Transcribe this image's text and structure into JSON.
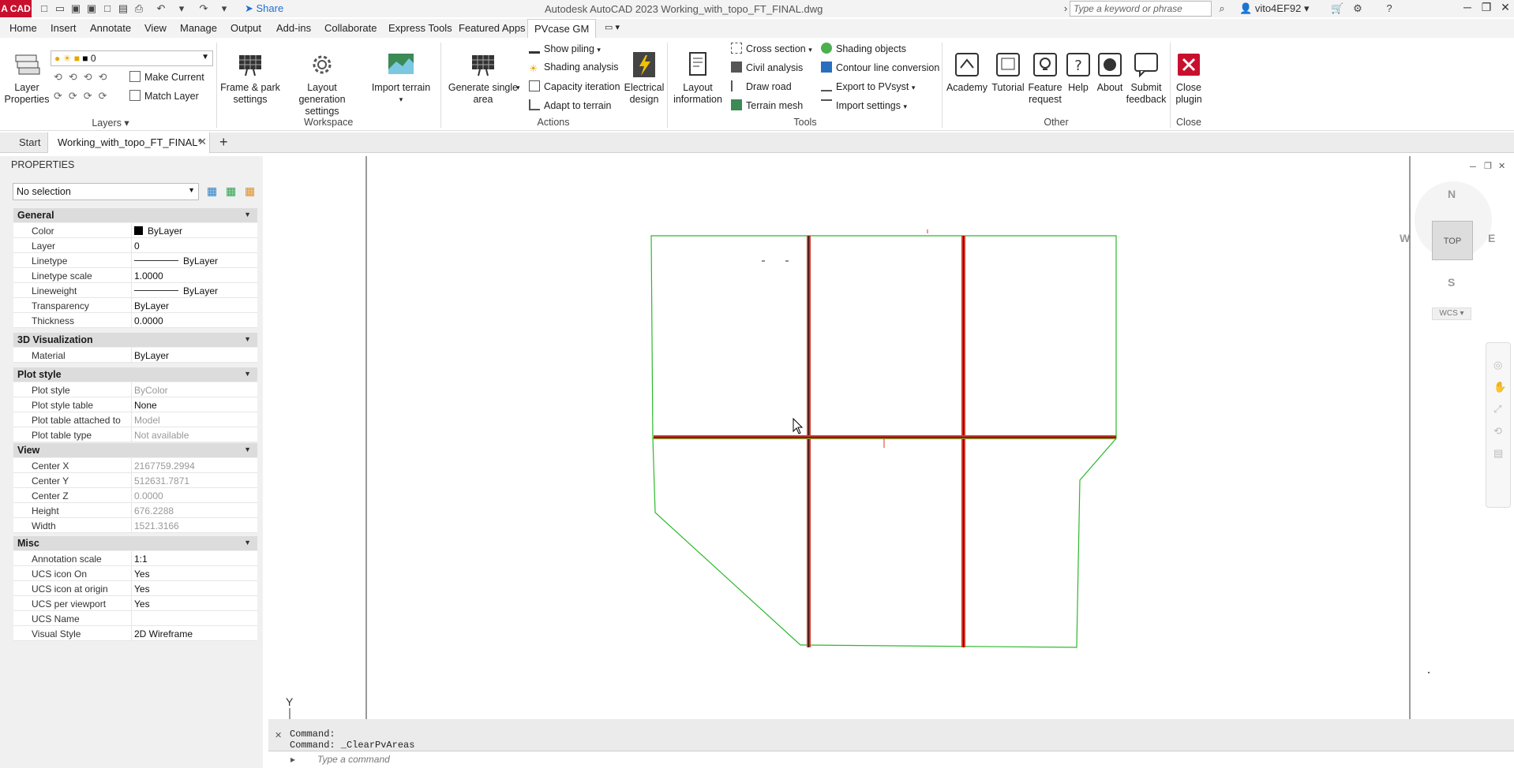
{
  "titlebar": {
    "logo": "A CAD",
    "share": "Share",
    "app_title": "Autodesk AutoCAD 2023   Working_with_topo_FT_FINAL.dwg",
    "search_placeholder": "Type a keyword or phrase",
    "user": "vito4EF92"
  },
  "menu": {
    "tabs": [
      "Home",
      "Insert",
      "Annotate",
      "View",
      "Manage",
      "Output",
      "Add-ins",
      "Collaborate",
      "Express Tools",
      "Featured Apps",
      "PVcase GM"
    ],
    "active": "PVcase GM"
  },
  "ribbon": {
    "layers": {
      "layer_properties": "Layer Properties",
      "layer_value": "0",
      "make_current": "Make Current",
      "match_layer": "Match Layer",
      "group": "Layers"
    },
    "workspace": {
      "frame_park": "Frame & park settings",
      "layout_gen": "Layout generation settings",
      "import_terrain": "Import terrain",
      "group": "Workspace"
    },
    "actions": {
      "generate_single": "Generate single area",
      "show_piling": "Show piling",
      "shading_analysis": "Shading analysis",
      "capacity_iteration": "Capacity iteration",
      "adapt_terrain": "Adapt to terrain",
      "electrical_design": "Electrical design",
      "group": "Actions"
    },
    "tools": {
      "layout_info": "Layout information",
      "cross_section": "Cross section",
      "civil_analysis": "Civil analysis",
      "draw_road": "Draw road",
      "terrain_mesh": "Terrain mesh",
      "shading_objects": "Shading objects",
      "contour_line": "Contour line conversion",
      "export_pvsyst": "Export to PVsyst",
      "import_settings": "Import settings",
      "group": "Tools"
    },
    "other": {
      "academy": "Academy",
      "tutorial": "Tutorial",
      "feature_request": "Feature request",
      "help": "Help",
      "about": "About",
      "submit_feedback": "Submit feedback",
      "group": "Other"
    },
    "close": {
      "close_plugin": "Close plugin",
      "group": "Close"
    }
  },
  "doctabs": {
    "start": "Start",
    "file": "Working_with_topo_FT_FINAL*"
  },
  "properties": {
    "title": "PROPERTIES",
    "selection": "No selection",
    "sections": {
      "general": "General",
      "viz3d": "3D Visualization",
      "plotstyle": "Plot style",
      "view": "View",
      "misc": "Misc"
    },
    "general": [
      [
        "Color",
        "ByLayer"
      ],
      [
        "Layer",
        "0"
      ],
      [
        "Linetype",
        "ByLayer"
      ],
      [
        "Linetype scale",
        "1.0000"
      ],
      [
        "Lineweight",
        "ByLayer"
      ],
      [
        "Transparency",
        "ByLayer"
      ],
      [
        "Thickness",
        "0.0000"
      ]
    ],
    "viz3d": [
      [
        "Material",
        "ByLayer"
      ]
    ],
    "plotstyle": [
      [
        "Plot style",
        "ByColor"
      ],
      [
        "Plot style table",
        "None"
      ],
      [
        "Plot table attached to",
        "Model"
      ],
      [
        "Plot table type",
        "Not available"
      ]
    ],
    "view": [
      [
        "Center X",
        "2167759.2994"
      ],
      [
        "Center Y",
        "512631.7871"
      ],
      [
        "Center Z",
        "0.0000"
      ],
      [
        "Height",
        "676.2288"
      ],
      [
        "Width",
        "1521.3166"
      ]
    ],
    "misc": [
      [
        "Annotation scale",
        "1:1"
      ],
      [
        "UCS icon On",
        "Yes"
      ],
      [
        "UCS icon at origin",
        "Yes"
      ],
      [
        "UCS per viewport",
        "Yes"
      ],
      [
        "UCS Name",
        ""
      ],
      [
        "Visual Style",
        "2D Wireframe"
      ]
    ]
  },
  "viewcube": {
    "n": "N",
    "s": "S",
    "e": "E",
    "w": "W",
    "top": "TOP",
    "wcs": "WCS"
  },
  "canvas": {
    "y_axis": "Y"
  },
  "command": {
    "line1": "Command:",
    "line2": "Command: _ClearPvAreas",
    "placeholder": "Type a command"
  },
  "colors": {
    "boundary": "#2db82d",
    "road": "#d63a2a",
    "accent": "#c8102e"
  }
}
